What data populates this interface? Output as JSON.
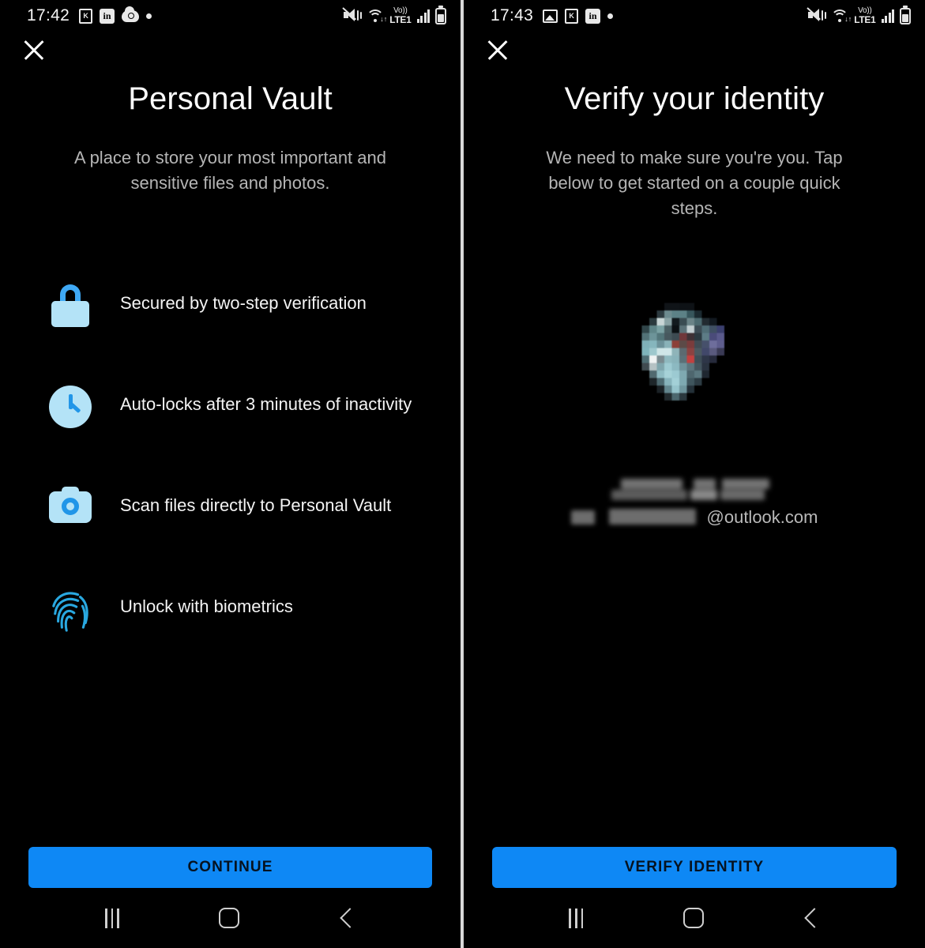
{
  "screens": [
    {
      "id": "personal-vault-intro",
      "statusbar": {
        "time": "17:42",
        "left_icons": [
          "notification-badge-icon",
          "linkedin-icon",
          "onedrive-cloud-icon",
          "more-dot-icon"
        ],
        "right_icons": [
          "mute-vibrate-icon",
          "wifi-icon",
          "volte-lte1-icon",
          "signal-bars-icon",
          "battery-icon"
        ],
        "volte_top": "Vo))",
        "volte_bottom": "LTE1",
        "linkedin_glyph": "in",
        "badge_glyph": "K"
      },
      "close_label": "×",
      "title": "Personal Vault",
      "subtitle": "A place to store your most important and sensitive files and photos.",
      "features": [
        {
          "icon": "lock-icon",
          "text": "Secured by two-step verification"
        },
        {
          "icon": "clock-icon",
          "text": "Auto-locks after 3 minutes of inactivity"
        },
        {
          "icon": "camera-icon",
          "text": "Scan files directly to Personal Vault"
        },
        {
          "icon": "fingerprint-icon",
          "text": "Unlock with biometrics"
        }
      ],
      "cta_label": "CONTINUE"
    },
    {
      "id": "verify-identity",
      "statusbar": {
        "time": "17:43",
        "left_icons": [
          "gallery-image-icon",
          "notification-badge-icon",
          "linkedin-icon",
          "more-dot-icon"
        ],
        "right_icons": [
          "mute-vibrate-icon",
          "wifi-icon",
          "volte-lte1-icon",
          "signal-bars-icon",
          "battery-icon"
        ],
        "volte_top": "Vo))",
        "volte_bottom": "LTE1",
        "linkedin_glyph": "in",
        "badge_glyph": "K"
      },
      "close_label": "×",
      "title": "Verify your identity",
      "subtitle": "We need to make sure you're you. Tap below to get started on a couple quick steps.",
      "account": {
        "avatar": "pixelated-profile-photo",
        "name_redacted": true,
        "email_suffix": "@outlook.com",
        "email_prefix_redacted": true
      },
      "cta_label": "VERIFY IDENTITY"
    }
  ],
  "navbar": {
    "recents_label": "recents-icon",
    "home_label": "home-icon",
    "back_label": "back-icon"
  },
  "colors": {
    "background": "#000000",
    "accent_button": "#0e88f5",
    "icon_light_blue": "#b4e3f7",
    "icon_blue": "#2196e8",
    "title_text": "#fcfcfc",
    "subtitle_text": "#b5b5b5",
    "feature_text": "#f4f4f4",
    "divider": "#d8d8d8"
  }
}
